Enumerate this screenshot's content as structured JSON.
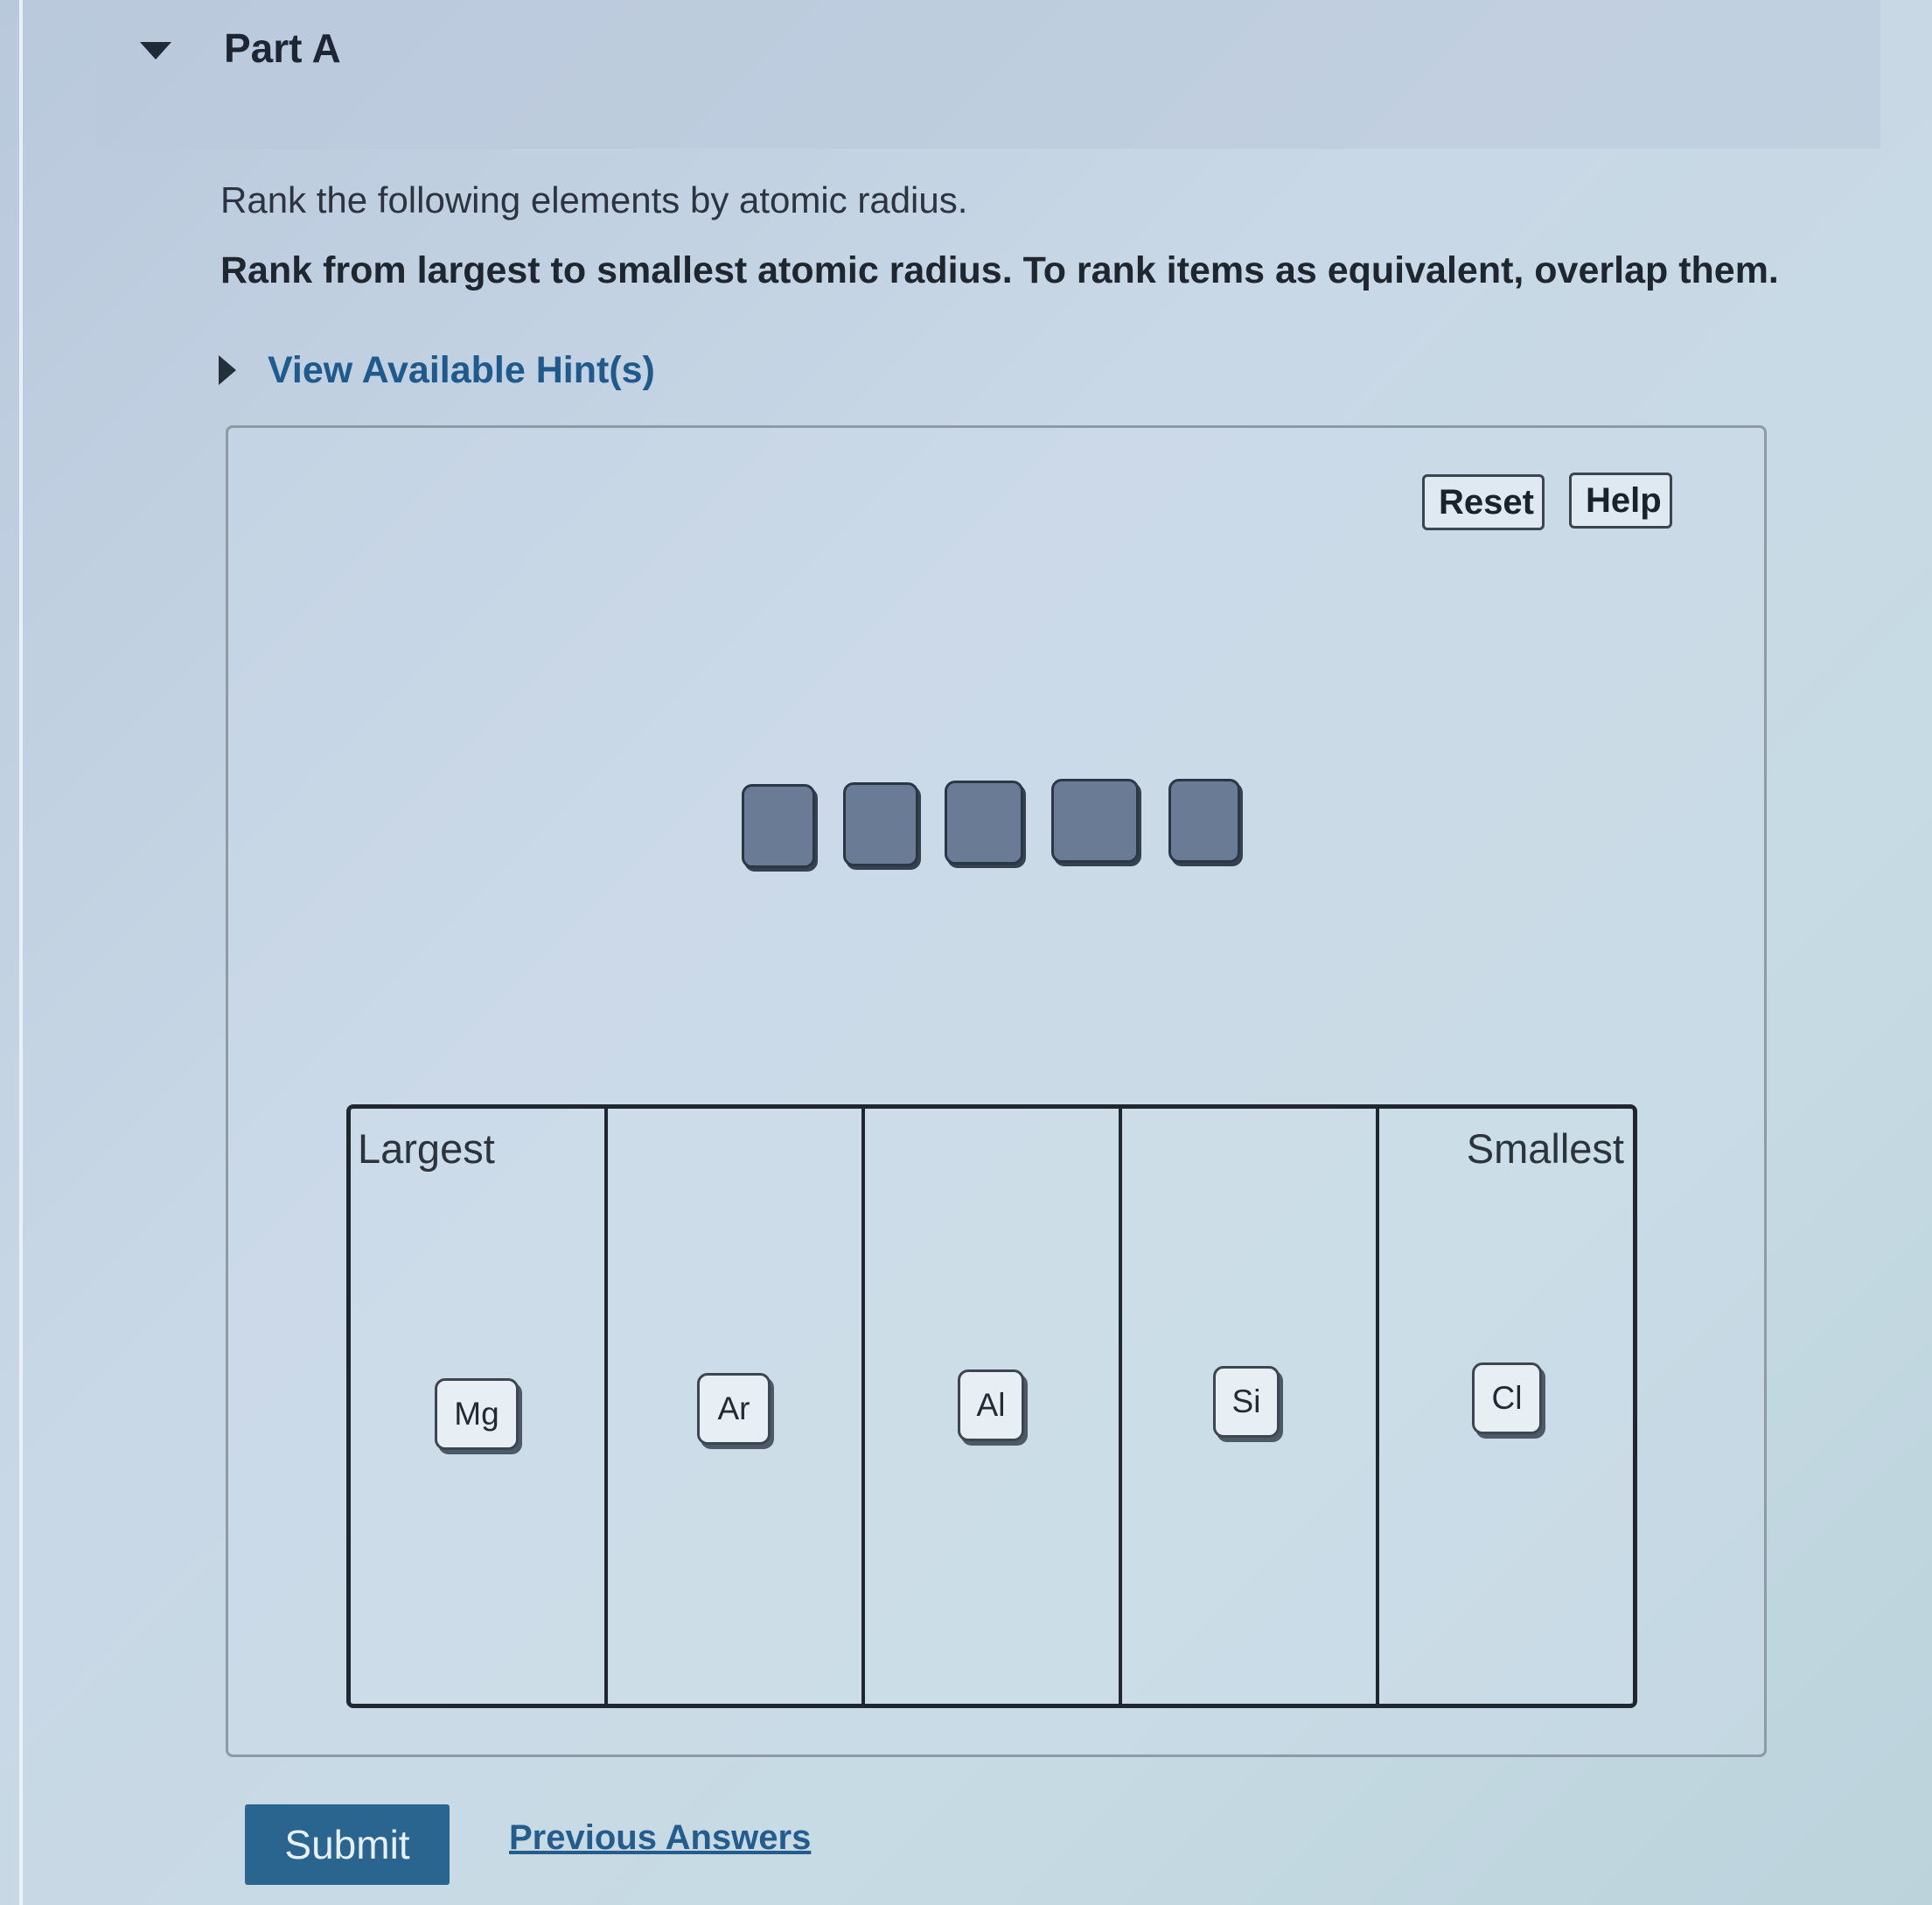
{
  "part": {
    "title": "Part A"
  },
  "question": {
    "prompt": "Rank the following elements by atomic radius.",
    "instruction": "Rank from largest to smallest atomic radius. To rank items as equivalent, overlap them."
  },
  "hint": {
    "label": "View Available Hint(s)"
  },
  "toolbar": {
    "reset_label": "Reset",
    "help_label": "Help"
  },
  "ranking": {
    "left_label": "Largest",
    "right_label": "Smallest",
    "bins": [
      {
        "element": "Mg"
      },
      {
        "element": "Ar"
      },
      {
        "element": "Al"
      },
      {
        "element": "Si"
      },
      {
        "element": "Cl"
      }
    ],
    "empty_slot_count": 5
  },
  "actions": {
    "submit_label": "Submit",
    "previous_answers_label": "Previous Answers"
  },
  "colors": {
    "submit_bg": "#2a6590",
    "link": "#245c8e",
    "slot_fill": "#6a7c95"
  }
}
